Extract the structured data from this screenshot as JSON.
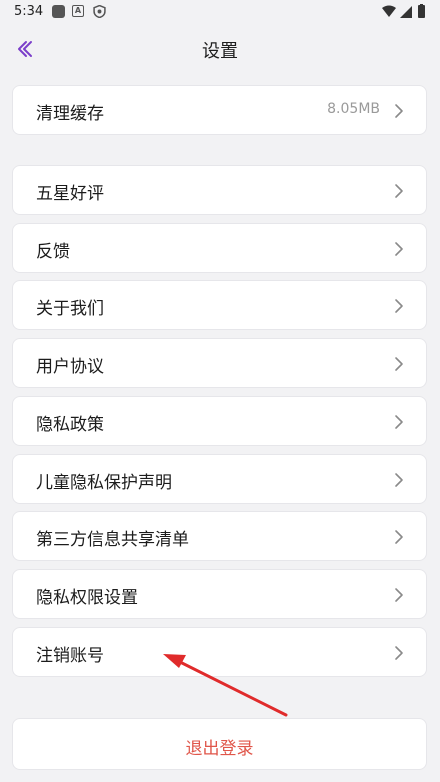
{
  "status": {
    "time": "5:34",
    "icons": [
      "notification-icon",
      "app-a-icon",
      "shield-icon",
      "wifi-icon",
      "signal-icon",
      "battery-icon"
    ]
  },
  "header": {
    "title": "设置",
    "back_icon": "back-chevron-icon"
  },
  "cache": {
    "label": "清理缓存",
    "value": "8.05MB"
  },
  "menu": [
    {
      "label": "五星好评"
    },
    {
      "label": "反馈"
    },
    {
      "label": "关于我们"
    },
    {
      "label": "用户协议"
    },
    {
      "label": "隐私政策"
    },
    {
      "label": "儿童隐私保护声明"
    },
    {
      "label": "第三方信息共享清单"
    },
    {
      "label": "隐私权限设置"
    },
    {
      "label": "注销账号"
    }
  ],
  "logout": {
    "label": "退出登录"
  },
  "colors": {
    "accent": "#7b3fc9",
    "danger": "#e0564a",
    "annotation_arrow": "#e02b2b"
  }
}
